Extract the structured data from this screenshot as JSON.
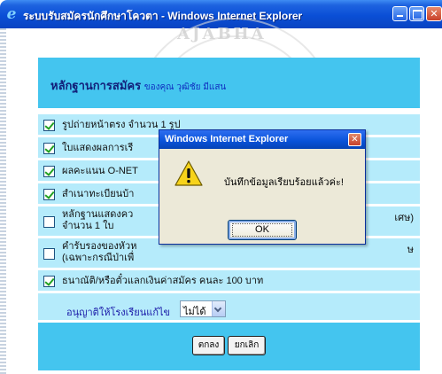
{
  "window": {
    "title": "ระบบรับสมัครนักศึกษาโควตา - Windows Internet Explorer"
  },
  "page": {
    "header_title": "หลักฐานการสมัคร",
    "header_owner": "ของคุณ วุฒิชัย มีแสน",
    "documents": [
      {
        "label": "รูปถ่ายหน้าตรง จำนวน 1 รูป",
        "checked": true
      },
      {
        "label": "ใบแสดงผลการเรี",
        "checked": true
      },
      {
        "label": "ผลคะแนน O-NET",
        "checked": true
      },
      {
        "label": "สำเนาทะเบียนบ้า",
        "checked": true
      },
      {
        "label": "หลักฐานแสดงคว",
        "label_line2": "จำนวน 1 ใบ",
        "label_tail": "เศษ)",
        "checked": false
      },
      {
        "label": "คำรับรองของหัวห",
        "label_line2": "(เฉพาะกรณีป่าเพื่",
        "label_tail": "ษ",
        "checked": false
      },
      {
        "label": "ธนาณัติ/หรือตั๋วแลกเงินค่าสมัคร คนละ 100 บาท",
        "checked": true
      }
    ],
    "permit_label": "อนุญาติให้โรงเรียนแก้ไข",
    "permit_value": "ไม่ได้",
    "submit_label": "ตกลง",
    "cancel_label": "ยกเลิก"
  },
  "watermark_text": "AJABHA",
  "dialog": {
    "title": "Windows Internet Explorer",
    "message": "บันทึกข้อมูลเรียบร้อยแล้วค่ะ!",
    "ok_label": "OK",
    "icon": "warning-icon"
  },
  "colors": {
    "header_band": "#44c5ef",
    "row_bg": "#b5ebfb",
    "titlebar": "#0a4fd6"
  }
}
